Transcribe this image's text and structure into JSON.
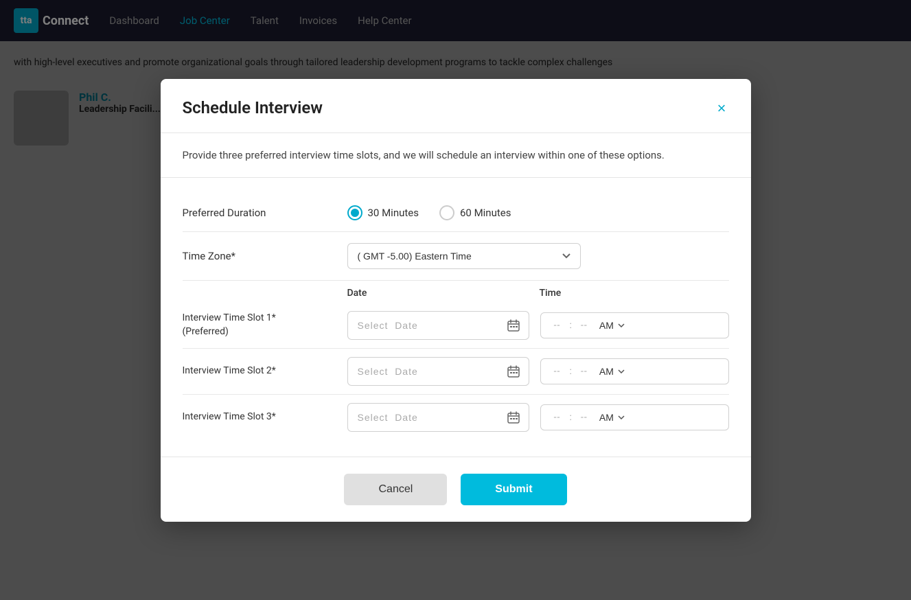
{
  "app": {
    "logo_text": "tta",
    "brand_name": "Connect"
  },
  "nav": {
    "links": [
      {
        "label": "Dashboard",
        "active": false
      },
      {
        "label": "Job Center",
        "active": true
      },
      {
        "label": "Talent",
        "active": false
      },
      {
        "label": "Invoices",
        "active": false
      },
      {
        "label": "Help Center",
        "active": false
      }
    ]
  },
  "modal": {
    "title": "Schedule Interview",
    "close_label": "×",
    "description": "Provide three preferred interview time slots, and we will schedule an interview within one of these options.",
    "preferred_duration_label": "Preferred Duration",
    "duration_options": [
      {
        "label": "30 Minutes",
        "value": "30",
        "selected": true
      },
      {
        "label": "60 Minutes",
        "value": "60",
        "selected": false
      }
    ],
    "timezone_label": "Time Zone*",
    "timezone_value": "(GMT -5.00) Eastern Time",
    "timezone_options": [
      {
        "label": "(GMT -5.00) Eastern Time",
        "value": "gmt-5-eastern"
      }
    ],
    "date_col_header": "Date",
    "time_col_header": "Time",
    "time_slots": [
      {
        "label": "Interview Time Slot 1*",
        "sublabel": "(Preferred)",
        "date_placeholder": "Select  Date",
        "time_hours": "--",
        "time_minutes": "--",
        "ampm": "AM"
      },
      {
        "label": "Interview Time Slot 2*",
        "sublabel": "",
        "date_placeholder": "Select  Date",
        "time_hours": "--",
        "time_minutes": "--",
        "ampm": "AM"
      },
      {
        "label": "Interview Time Slot 3*",
        "sublabel": "",
        "date_placeholder": "Select  Date",
        "time_hours": "--",
        "time_minutes": "--",
        "ampm": "AM"
      }
    ],
    "cancel_label": "Cancel",
    "submit_label": "Submit"
  }
}
